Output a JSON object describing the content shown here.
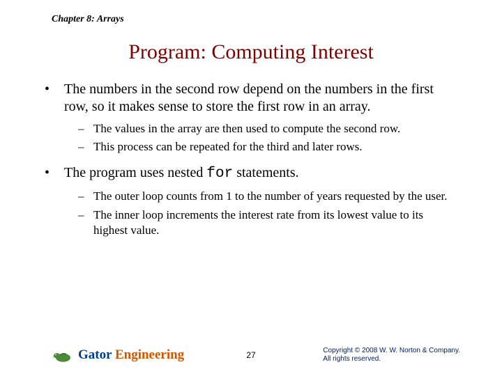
{
  "chapter": "Chapter 8: Arrays",
  "title": "Program: Computing Interest",
  "bullets": [
    {
      "text": "The numbers in the second row depend on the numbers in the first row, so it makes sense to store the first row in an array.",
      "subs": [
        "The values in the array are then used to compute the second row.",
        "This process can be repeated for the third and later rows."
      ]
    },
    {
      "text_pre": "The program uses nested ",
      "text_code": "for",
      "text_post": " statements.",
      "subs": [
        "The outer loop counts from 1 to the number of years requested by the user.",
        "The inner loop increments the interest rate from its lowest value to its highest value."
      ]
    }
  ],
  "footer": {
    "logo_word1": "Gator ",
    "logo_word2": "Engineering",
    "page": "27",
    "copyright_line1": "Copyright © 2008 W. W. Norton & Company.",
    "copyright_line2": "All rights reserved."
  }
}
